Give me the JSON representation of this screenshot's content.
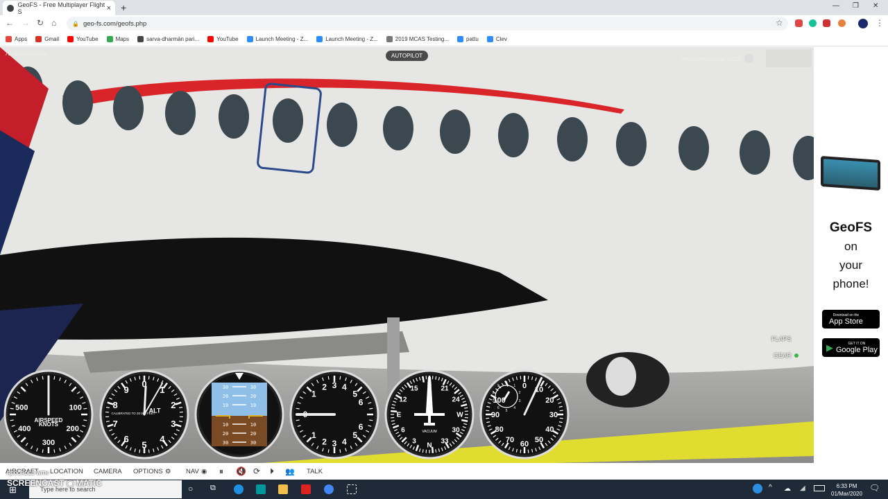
{
  "browser": {
    "tab_title": "GeoFS - Free Multiplayer Flight S",
    "new_tab": "+",
    "url": "geo-fs.com/geofs.php",
    "bookmarks": [
      {
        "label": "Apps",
        "color": "#e8453c"
      },
      {
        "label": "Gmail",
        "color": "#d93025"
      },
      {
        "label": "YouTube",
        "color": "#ff0000"
      },
      {
        "label": "Maps",
        "color": "#34a853"
      },
      {
        "label": "sarva-dharmān pari...",
        "color": "#444444"
      },
      {
        "label": "YouTube",
        "color": "#ff0000"
      },
      {
        "label": "Launch Meeting - Z...",
        "color": "#2d8cff"
      },
      {
        "label": "Launch Meeting - Z...",
        "color": "#2d8cff"
      },
      {
        "label": "2019 MCAS Testing...",
        "color": "#777777"
      },
      {
        "label": "pattu",
        "color": "#2d8cff"
      },
      {
        "label": "Clev",
        "color": "#2d8cff"
      }
    ],
    "window_controls": [
      "—",
      "❐",
      "✕"
    ]
  },
  "game": {
    "players_online": "79 players online",
    "autopilot": "AUTOPILOT",
    "username": "AwesomeAirplanes20",
    "sign_out": "SIGN OUT",
    "flaps": "FLAPS",
    "gear": "GEAR",
    "gear_status_color": "#3bb54a",
    "colors": {
      "fuselage": "#e4e4e2",
      "stripe": "#d9252a",
      "window": "#3c4850",
      "wing": "#111111",
      "taxi_line": "#e8e020"
    }
  },
  "gauges": {
    "airspeed": {
      "title": "AIRSPEED",
      "unit": "KNOTS",
      "labels": [
        "100",
        "200",
        "300",
        "400",
        "500"
      ]
    },
    "altimeter": {
      "title": "ALT",
      "calibration": "CALIBRATED TO 20 000 FEET",
      "labels": [
        "0",
        "1",
        "2",
        "3",
        "4",
        "5",
        "6",
        "7",
        "8",
        "9"
      ]
    },
    "attitude": {
      "pitch_labels": [
        "30",
        "20",
        "10",
        "10",
        "20",
        "30"
      ]
    },
    "vsi": {
      "labels_up": [
        "0",
        "1",
        "2",
        "3",
        "4",
        "5",
        "6"
      ],
      "labels_down": [
        "1",
        "2",
        "3",
        "4",
        "5",
        "6"
      ]
    },
    "heading": {
      "label": "VACUUM",
      "labels": [
        "S",
        "21",
        "24",
        "W",
        "30",
        "33",
        "N",
        "3",
        "6",
        "E",
        "12",
        "15"
      ]
    },
    "tachometer": {
      "labels": [
        "0",
        "10",
        "20",
        "30",
        "40",
        "50",
        "60",
        "70",
        "80",
        "90",
        "100"
      ],
      "subdial": [
        "0",
        "1",
        "2",
        "3",
        "4",
        "5",
        "6",
        "7",
        "8",
        "9"
      ]
    }
  },
  "menu": {
    "items": [
      "AIRCRAFT",
      "LOCATION",
      "CAMERA",
      "OPTIONS",
      "NAV",
      "TALK"
    ]
  },
  "ad": {
    "title": "GeoFS",
    "line1": "on",
    "line2": "your",
    "line3": "phone!",
    "appstore_small": "Download on the",
    "appstore": "App Store",
    "play_small": "GET IT ON",
    "play": "Google Play"
  },
  "taskbar": {
    "search_placeholder": "Type here to search",
    "time": "6:33 PM",
    "date": "01/Mar/2020",
    "notifications": "8"
  },
  "watermark": {
    "line1": "RECORDED WITH",
    "line2": "SCREENCAST",
    "line3": "MATIC"
  }
}
